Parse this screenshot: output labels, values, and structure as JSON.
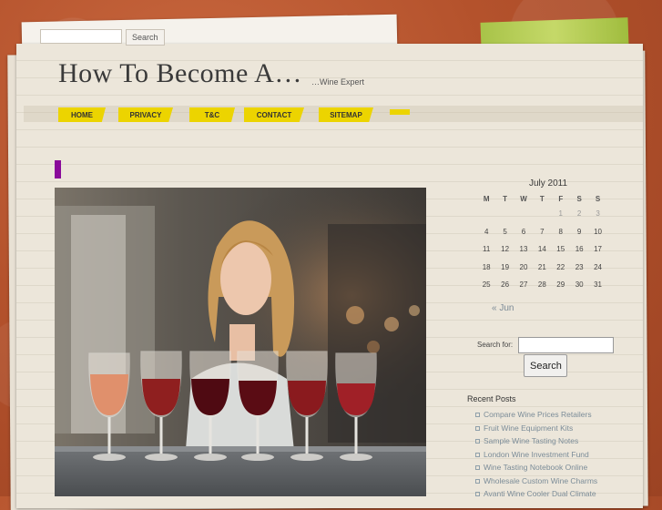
{
  "top_search": {
    "button_label": "Search",
    "value": ""
  },
  "header": {
    "title": "How To Become A…",
    "tagline": "…Wine Expert"
  },
  "nav": {
    "items": [
      {
        "label": "HOME"
      },
      {
        "label": "PRIVACY"
      },
      {
        "label": "T&C"
      },
      {
        "label": "CONTACT"
      },
      {
        "label": "SITEMAP"
      }
    ]
  },
  "post": {
    "image_subject": "woman with wine glasses"
  },
  "calendar": {
    "caption": "July 2011",
    "weekdays": [
      "M",
      "T",
      "W",
      "T",
      "F",
      "S",
      "S"
    ],
    "weeks": [
      [
        "",
        "",
        "",
        "",
        "1",
        "2",
        "3"
      ],
      [
        "4",
        "5",
        "6",
        "7",
        "8",
        "9",
        "10"
      ],
      [
        "11",
        "12",
        "13",
        "14",
        "15",
        "16",
        "17"
      ],
      [
        "18",
        "19",
        "20",
        "21",
        "22",
        "23",
        "24"
      ],
      [
        "25",
        "26",
        "27",
        "28",
        "29",
        "30",
        "31"
      ]
    ],
    "prev_label": "« Jun"
  },
  "sidebar_search": {
    "label": "Search for:",
    "value": "",
    "button_label": "Search"
  },
  "recent_posts": {
    "title": "Recent Posts",
    "items": [
      "Compare Wine Prices Retailers",
      "Fruit Wine Equipment Kits",
      "Sample Wine Tasting Notes",
      "London Wine Investment Fund",
      "Wine Tasting Notebook Online",
      "Wholesale Custom Wine Charms",
      "Avanti Wine Cooler Dual Climate"
    ]
  },
  "colors": {
    "nav_yellow": "#ecd400",
    "post_marker": "#8a0a9a",
    "link": "#7b8c98",
    "background": "#b4522c"
  },
  "icons": [
    "post-marker-icon",
    "list-bullet-icon"
  ]
}
